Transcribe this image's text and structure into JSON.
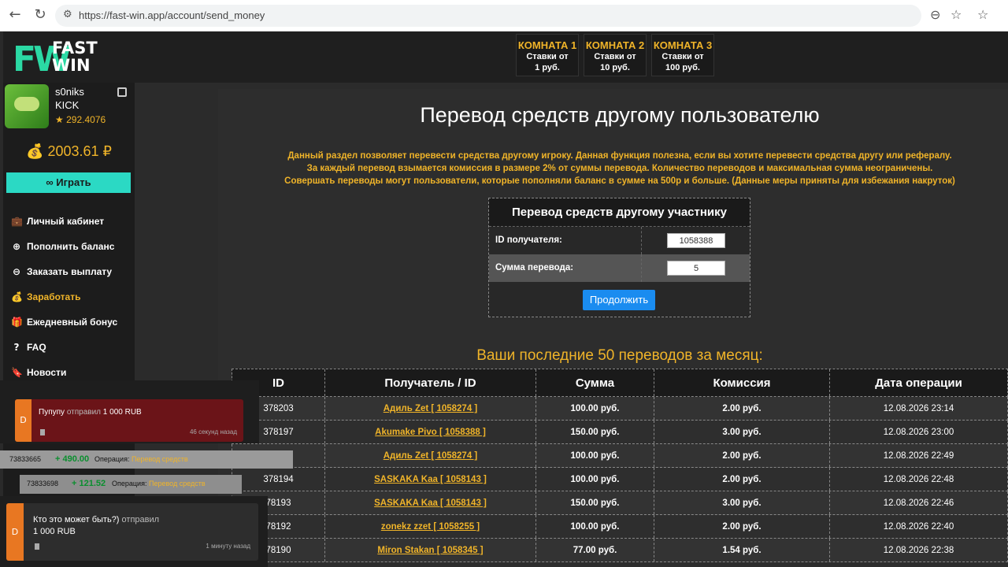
{
  "browser": {
    "url": "https://fast-win.app/account/send_money"
  },
  "logo": {
    "mark": "FW",
    "line1": "FAST",
    "line2": "WIN"
  },
  "rooms": [
    {
      "title": "КОМНАТА 1",
      "line1": "Ставки от",
      "line2": "1 руб."
    },
    {
      "title": "КОМНАТА 2",
      "line1": "Ставки от",
      "line2": "10 руб."
    },
    {
      "title": "КОМНАТА 3",
      "line1": "Ставки от",
      "line2": "100 руб."
    }
  ],
  "user": {
    "name": "s0niks",
    "tag": "KICK",
    "rating": "★ 292.4076",
    "balance": "💰 2003.61 ₽"
  },
  "play_label": "∞ Играть",
  "menu": [
    {
      "icon": "💼",
      "label": "Личный кабинет"
    },
    {
      "icon": "⊕",
      "label": "Пополнить баланс"
    },
    {
      "icon": "⊖",
      "label": "Заказать выплату"
    },
    {
      "icon": "💰",
      "label": "Заработать"
    },
    {
      "icon": "🎁",
      "label": "Ежедневный бонус"
    },
    {
      "icon": "?",
      "label": "FAQ"
    },
    {
      "icon": "🔖",
      "label": "Новости"
    }
  ],
  "page": {
    "title": "Перевод средств другому пользователю",
    "info1": "Данный раздел позволяет перевести средства другому игроку. Данная функция полезна, если вы хотите перевести средства другу или рефералу.",
    "info2": "За каждый перевод взымается комиссия в размере 2% от суммы перевода. Количество переводов и максимальная сумма неограничены.",
    "info3": "Совершать переводы могут пользователи, которые пополняли баланс в сумме на 500р и больше. (Данные меры приняты для избежания накруток)"
  },
  "form": {
    "title": "Перевод средств другому участнику",
    "recipient_label": "ID получателя:",
    "recipient_value": "1058388",
    "amount_label": "Сумма перевода:",
    "amount_value": "5",
    "submit": "Продолжить"
  },
  "recent": {
    "title": "Ваши последние 50 переводов за месяц:",
    "columns": [
      "ID",
      "Получатель / ID",
      "Сумма",
      "Комиссия",
      "Дата операции"
    ],
    "rows": [
      [
        "378203",
        "Адиль Zet [ 1058274 ]",
        "100.00 руб.",
        "2.00 руб.",
        "12.08.2026 23:14"
      ],
      [
        "378197",
        "Akumake Pivo [ 1058388 ]",
        "150.00 руб.",
        "3.00 руб.",
        "12.08.2026 23:00"
      ],
      [
        "",
        "Адиль Zet [ 1058274 ]",
        "100.00 руб.",
        "2.00 руб.",
        "12.08.2026 22:49"
      ],
      [
        "378194",
        "SASKAKA Kaa [ 1058143 ]",
        "100.00 руб.",
        "2.00 руб.",
        "12.08.2026 22:48"
      ],
      [
        "78193",
        "SASKAKA Kaa [ 1058143 ]",
        "150.00 руб.",
        "3.00 руб.",
        "12.08.2026 22:46"
      ],
      [
        "78192",
        "zonekz zzet [ 1058255 ]",
        "100.00 руб.",
        "2.00 руб.",
        "12.08.2026 22:40"
      ],
      [
        "78190",
        "Miron Stakan [ 1058345 ]",
        "77.00 руб.",
        "1.54 руб.",
        "12.08.2026 22:38"
      ]
    ]
  },
  "toast1": {
    "name": "Пупупу",
    "action": "отправил",
    "amount": "1 000 RUB",
    "time": "46 секунд назад"
  },
  "op1": {
    "id": "73833665",
    "amount": "+ 490.00",
    "label": "Операция:",
    "type": "Перевод средств"
  },
  "op2": {
    "id": "73833698",
    "amount": "+ 121.52",
    "label": "Операция:",
    "type": "Перевод средств"
  },
  "toast2": {
    "name": "Кто это может быть?)",
    "action": "отправил",
    "amount": "1 000 RUB",
    "time": "1 минуту назад"
  }
}
